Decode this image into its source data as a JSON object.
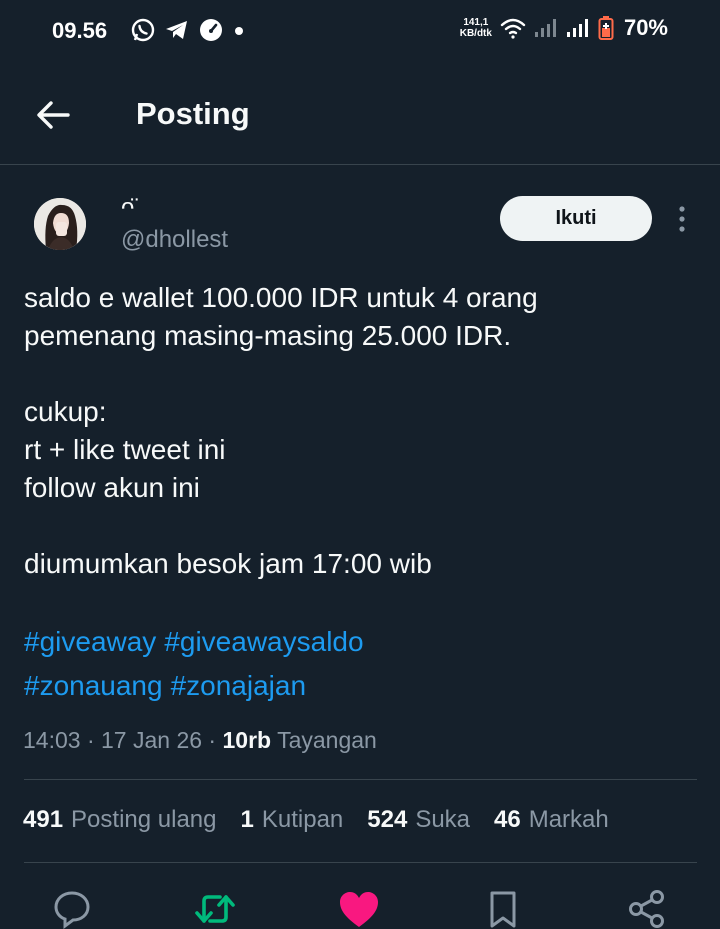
{
  "status_bar": {
    "time": "09.56",
    "net_speed_value": "141,1",
    "net_speed_unit": "KB/dtk",
    "battery": "70%"
  },
  "header": {
    "title": "Posting"
  },
  "author": {
    "display_name": "ᴖ̈",
    "handle": "@dhollest",
    "follow_label": "Ikuti"
  },
  "tweet": {
    "lines": [
      "saldo e wallet 100.000 IDR untuk 4 orang",
      "pemenang masing-masing 25.000 IDR.",
      "",
      "cukup:",
      "rt + like tweet ini",
      "follow akun ini",
      "",
      "diumumkan besok jam 17:00 wib"
    ],
    "hashtags": [
      "#giveaway",
      "#giveawaysaldo",
      "#zonauang",
      "#zonajajan"
    ]
  },
  "meta": {
    "time": "14:03",
    "date": "17 Jan 26",
    "views_count": "10rb",
    "views_label": "Tayangan"
  },
  "stats": {
    "reposts_count": "491",
    "reposts_label": "Posting ulang",
    "quotes_count": "1",
    "quotes_label": "Kutipan",
    "likes_count": "524",
    "likes_label": "Suka",
    "bookmarks_count": "46",
    "bookmarks_label": "Markah"
  },
  "colors": {
    "background": "#15202b",
    "link": "#1d9bf0",
    "repost_active": "#00ba7c",
    "like_active": "#f91880"
  }
}
